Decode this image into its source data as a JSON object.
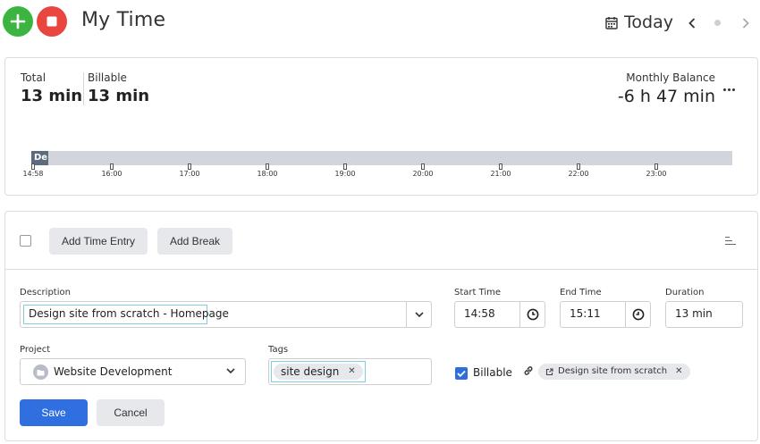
{
  "header": {
    "title": "My Time",
    "date_label": "Today"
  },
  "summary": {
    "total_label": "Total",
    "total_value": "13 min",
    "billable_label": "Billable",
    "billable_value": "13 min",
    "balance_label": "Monthly Balance",
    "balance_value": "-6 h 47 min"
  },
  "timeline": {
    "entry_label": "De",
    "ticks": [
      "14:58",
      "16:00",
      "17:00",
      "18:00",
      "19:00",
      "20:00",
      "21:00",
      "22:00",
      "23:00"
    ]
  },
  "toolbar": {
    "add_entry_label": "Add Time Entry",
    "add_break_label": "Add Break"
  },
  "form": {
    "description_label": "Description",
    "description_value": "Design site from scratch - Homepage",
    "start_label": "Start Time",
    "start_value": "14:58",
    "end_label": "End Time",
    "end_value": "15:11",
    "duration_label": "Duration",
    "duration_value": "13 min",
    "project_label": "Project",
    "project_value": "Website Development",
    "tags_label": "Tags",
    "tag_value": "site design",
    "billable_label": "Billable",
    "billable_checked": true,
    "task_value": "Design site from scratch",
    "save_label": "Save",
    "cancel_label": "Cancel"
  },
  "colors": {
    "add": "#3cb540",
    "stop": "#e8463e",
    "primary": "#2f6fe0",
    "timeline_bg": "#d2d6dc",
    "timeline_entry": "#5d6c7c",
    "focus": "#7fd0de"
  },
  "icons": {
    "add": "plus-icon",
    "stop": "stop-icon",
    "calendar": "calendar-icon",
    "prev": "chevron-left-icon",
    "next": "chevron-right-icon",
    "more": "more-horizontal-icon",
    "sort": "sort-icon",
    "clock": "clock-icon",
    "folder": "folder-icon",
    "link": "link-icon",
    "external": "external-link-icon"
  }
}
